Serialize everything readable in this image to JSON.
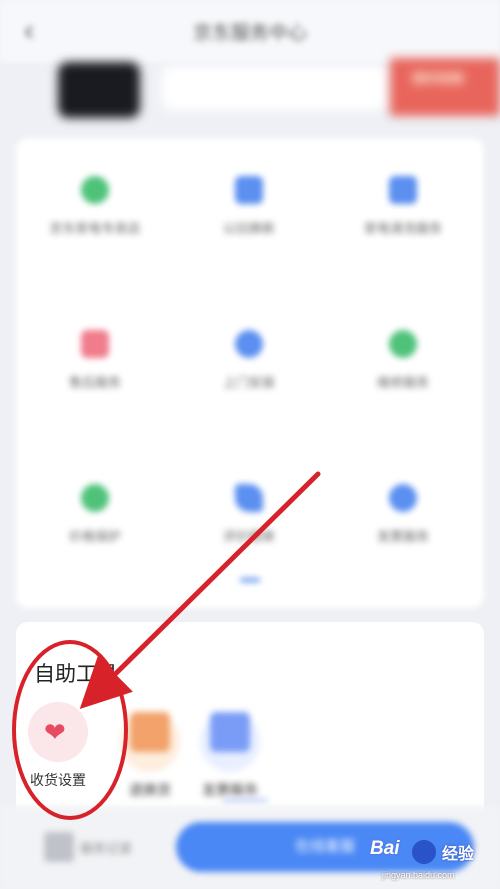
{
  "header": {
    "back_glyph": "‹",
    "title": "京东服务中心"
  },
  "banner": {
    "promo_text": "限时抢购"
  },
  "services": [
    {
      "label": "京东家电专卖店",
      "icon": "circle-icon",
      "color": "#4fc27a"
    },
    {
      "label": "以旧换新",
      "icon": "square-icon",
      "color": "#5b8ff0"
    },
    {
      "label": "家电清洗服务",
      "icon": "square-icon",
      "color": "#5b8ff0"
    },
    {
      "label": "售后服务",
      "icon": "chat-icon",
      "color": "#f07c8c"
    },
    {
      "label": "上门安装",
      "icon": "person-icon",
      "color": "#5b8ff0"
    },
    {
      "label": "维修服务",
      "icon": "circle-icon",
      "color": "#4fc27a"
    },
    {
      "label": "价格保护",
      "icon": "circle-icon",
      "color": "#4fc27a"
    },
    {
      "label": "评价晒单",
      "icon": "pencil-icon",
      "color": "#5b8ff0"
    },
    {
      "label": "发票服务",
      "icon": "circle-icon",
      "color": "#5b8ff0"
    }
  ],
  "tools": {
    "title": "自助工具",
    "items": [
      {
        "label": "收货设置",
        "icon": "heart-icon",
        "color": "#e84a62",
        "bg": "#fbe6ea"
      },
      {
        "label": "退换货",
        "icon": "box-icon",
        "color": "#f2a26a",
        "bg": "#fdeede"
      },
      {
        "label": "发票服务",
        "icon": "card-icon",
        "color": "#7a9cf6",
        "bg": "#e8efff"
      }
    ]
  },
  "bottom": {
    "left_label": "服务记录",
    "button_label": "在线客服"
  },
  "watermark": {
    "brand": "Bai",
    "cn": "经验",
    "url": "jingyan.baidu.com"
  },
  "annotation": {
    "color": "#d8222a",
    "target": "收货设置"
  }
}
